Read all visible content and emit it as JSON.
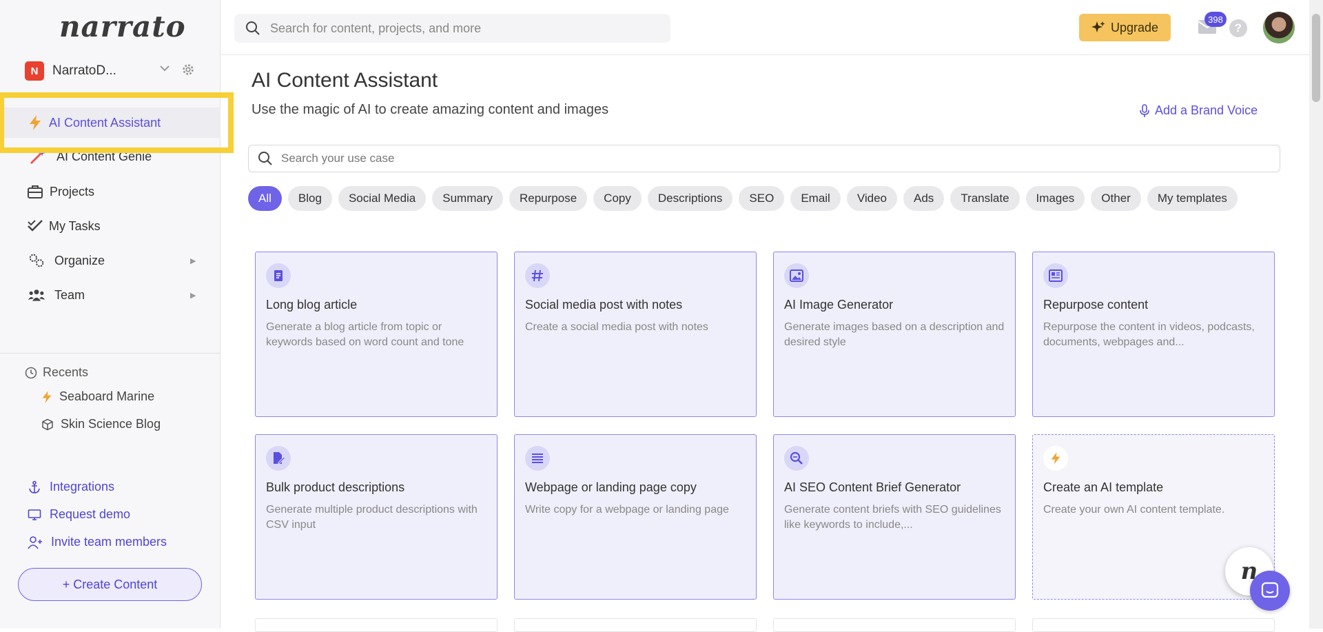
{
  "app": {
    "logo_text": "narrato"
  },
  "workspace": {
    "badge": "N",
    "name": "NarratoD..."
  },
  "sidebar": {
    "nav": [
      {
        "label": "AI Content Assistant",
        "icon": "lightning-icon",
        "active": true
      },
      {
        "label": "AI Content Genie",
        "icon": "magic-wand-icon"
      },
      {
        "label": "Projects",
        "icon": "briefcase-icon"
      },
      {
        "label": "My Tasks",
        "icon": "check-icon"
      },
      {
        "label": "Organize",
        "icon": "gears-icon",
        "arrow": "▶"
      },
      {
        "label": "Team",
        "icon": "team-icon",
        "arrow": "▶"
      }
    ],
    "recents_label": "Recents",
    "recents": [
      {
        "label": "Seaboard Marine",
        "icon": "lightning-icon"
      },
      {
        "label": "Skin Science Blog",
        "icon": "cube-icon"
      }
    ],
    "links": [
      {
        "label": "Integrations",
        "icon": "anchor-icon"
      },
      {
        "label": "Request demo",
        "icon": "monitor-icon"
      },
      {
        "label": "Invite team members",
        "icon": "add-user-icon"
      }
    ],
    "create_button": "+ Create Content"
  },
  "topbar": {
    "search_placeholder": "Search for content, projects, and more",
    "upgrade_label": "Upgrade",
    "mail_count": "398",
    "help_label": "?"
  },
  "main": {
    "title": "AI Content Assistant",
    "subtitle": "Use the magic of AI to create amazing content and images",
    "brand_voice": "Add a Brand Voice",
    "usecase_placeholder": "Search your use case",
    "chips": [
      "All",
      "Blog",
      "Social Media",
      "Summary",
      "Repurpose",
      "Copy",
      "Descriptions",
      "SEO",
      "Email",
      "Video",
      "Ads",
      "Translate",
      "Images",
      "Other",
      "My templates"
    ],
    "cards": [
      {
        "title": "Long blog article",
        "desc": "Generate a blog article from topic or keywords based on word count and tone",
        "icon": "document-icon"
      },
      {
        "title": "Social media post with notes",
        "desc": "Create a social media post with notes",
        "icon": "hashtag-icon"
      },
      {
        "title": "AI Image Generator",
        "desc": "Generate images based on a description and desired style",
        "icon": "image-icon"
      },
      {
        "title": "Repurpose content",
        "desc": "Repurpose the content in videos, podcasts, documents, webpages and...",
        "icon": "newspaper-icon"
      },
      {
        "title": "Bulk product descriptions",
        "desc": "Generate multiple product descriptions with CSV input",
        "icon": "file-edit-icon"
      },
      {
        "title": "Webpage or landing page copy",
        "desc": "Write copy for a webpage or landing page",
        "icon": "lines-icon"
      },
      {
        "title": "AI SEO Content Brief Generator",
        "desc": "Generate content briefs with SEO guidelines like keywords to include,...",
        "icon": "search-doc-icon"
      },
      {
        "title": "Create an AI template",
        "desc": "Create your own AI content template.",
        "icon": "lightning-icon"
      }
    ],
    "chat_logo": "n"
  },
  "colors": {
    "accent": "#6f63e8",
    "upgrade": "#f5c45e",
    "highlight": "#f7cf36"
  }
}
